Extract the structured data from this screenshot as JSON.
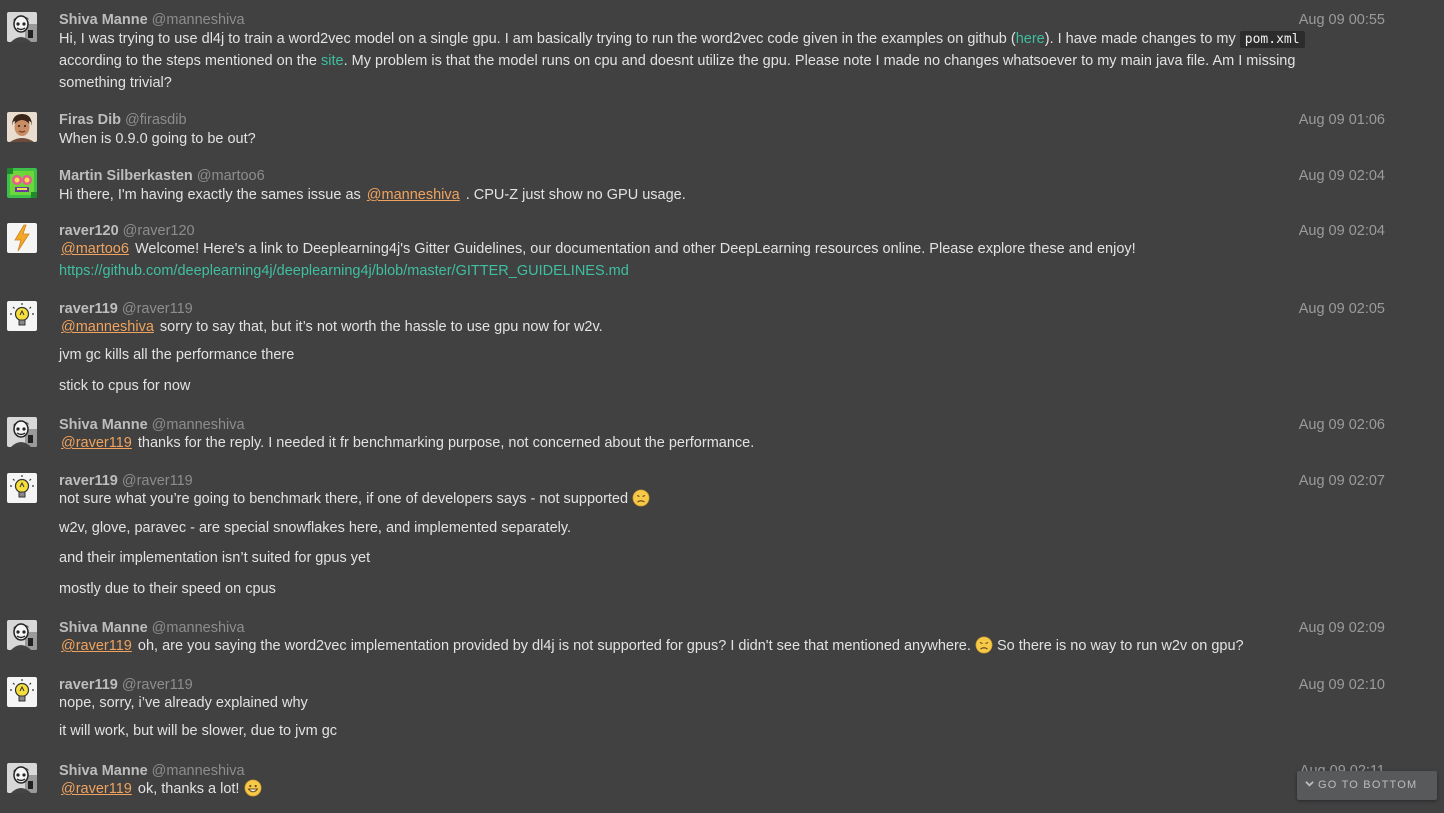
{
  "messages": [
    {
      "name": "Shiva Manne",
      "handle": "@manneshiva",
      "time": "Aug 09 00:55",
      "line1_a": "Hi, I was trying to use dl4j to train a word2vec model on a single gpu. I am basically trying to run the word2vec code given in the examples on github (",
      "line1_link": "here",
      "line1_b": "). I have made changes to my ",
      "line1_code": "pom.xml",
      "line2_a": "according to the steps mentioned on the ",
      "line2_link": "site",
      "line2_b": ". My problem is that the model runs on cpu and doesnt utilize the gpu. Please note I made no changes whatsoever to my main java file. Am I missing",
      "line3": "something trivial?"
    },
    {
      "name": "Firas Dib",
      "handle": "@firasdib",
      "time": "Aug 09 01:06",
      "text": "When is 0.9.0 going to be out?"
    },
    {
      "name": "Martin Silberkasten",
      "handle": "@martoo6",
      "time": "Aug 09 02:04",
      "text_a": "Hi there, I'm having exactly the sames issue as ",
      "mention": "@manneshiva",
      "text_b": " . CPU-Z just show no GPU usage."
    },
    {
      "name": "raver120",
      "handle": "@raver120",
      "time": "Aug 09 02:04",
      "mention": "@martoo6",
      "text": " Welcome! Here's a link to Deeplearning4j's Gitter Guidelines, our documentation and other DeepLearning resources online. Please explore these and enjoy!",
      "link": "https://github.com/deeplearning4j/deeplearning4j/blob/master/GITTER_GUIDELINES.md"
    },
    {
      "name": "raver119",
      "handle": "@raver119",
      "time": "Aug 09 02:05",
      "mention": "@manneshiva",
      "text1": " sorry to say that, but it’s not worth the hassle to use gpu now for w2v.",
      "text2": "jvm gc kills all the performance there",
      "text3": "stick to cpus for now"
    },
    {
      "name": "Shiva Manne",
      "handle": "@manneshiva",
      "time": "Aug 09 02:06",
      "mention": "@raver119",
      "text": " thanks for the reply. I needed it fr benchmarking purpose, not concerned about the performance."
    },
    {
      "name": "raver119",
      "handle": "@raver119",
      "time": "Aug 09 02:07",
      "text1": "not sure what you’re going to benchmark there, if one of developers says - not supported ",
      "text2": "w2v, glove, paravec - are special snowflakes here, and implemented separately.",
      "text3": "and their implementation isn’t suited for gpus yet",
      "text4": "mostly due to their speed on cpus"
    },
    {
      "name": "Shiva Manne",
      "handle": "@manneshiva",
      "time": "Aug 09 02:09",
      "mention": "@raver119",
      "text_a": " oh, are you saying the word2vec implementation provided by dl4j is not supported for gpus? I didn't see that mentioned anywhere. ",
      "text_b": " So there is no way to run w2v on gpu?"
    },
    {
      "name": "raver119",
      "handle": "@raver119",
      "time": "Aug 09 02:10",
      "text1": "nope, sorry, i’ve already explained why",
      "text2": "it will work, but will be slower, due to jvm gc"
    },
    {
      "name": "Shiva Manne",
      "handle": "@manneshiva",
      "time": "Aug 09 02:11",
      "mention": "@raver119",
      "text": " ok, thanks a lot! "
    }
  ],
  "goto_bottom": "GO TO BOTTOM",
  "colors": {
    "background": "#414142",
    "mention": "#f0a35e",
    "link": "#3fbfa0"
  }
}
